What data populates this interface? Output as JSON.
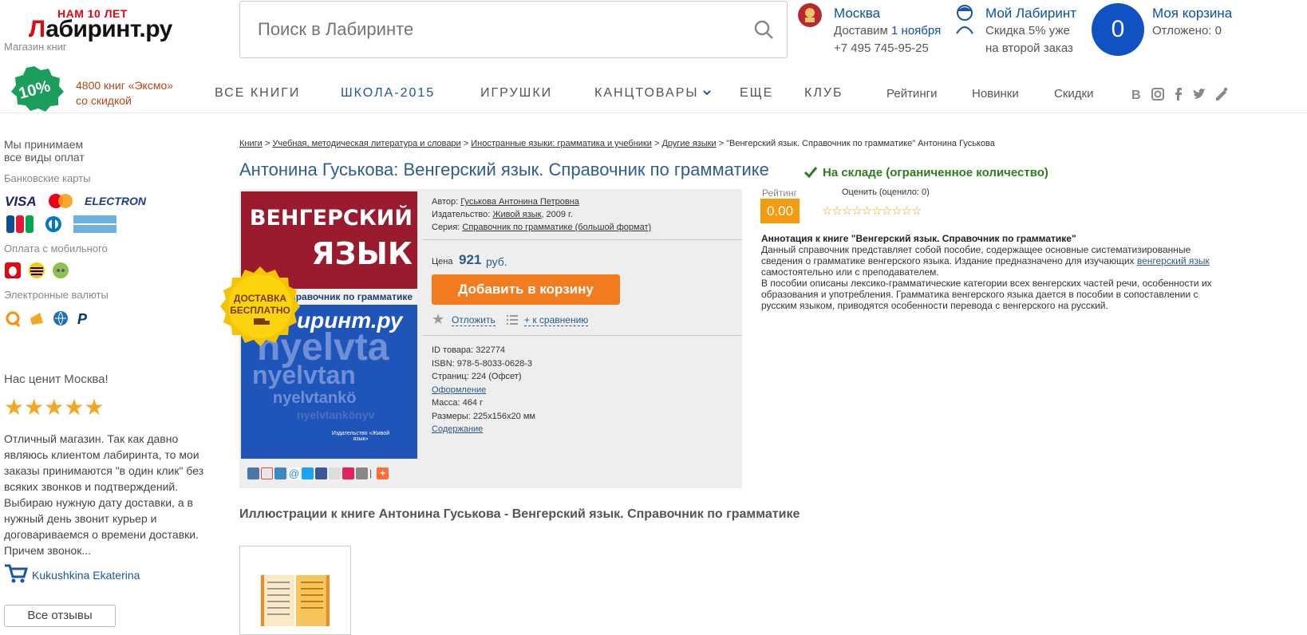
{
  "header": {
    "logo_top": "НАМ 10 ЛЕТ",
    "logo_l": "Л",
    "logo_rest": "абиринт.ру",
    "logo_sub": "Магазин книг",
    "search_placeholder": "Поиск в Лабиринте",
    "city": "Москва",
    "delivery_prefix": "Доставим",
    "delivery_date": "1 ноября",
    "phone": "+7 495 745-95-25",
    "my_title": "Мой Лабиринт",
    "my_line1": "Скидка 5% уже",
    "my_line2": "на второй заказ",
    "cart_count": "0",
    "cart_title": "Моя корзина",
    "cart_postponed": "Отложено: 0"
  },
  "promo": {
    "badge": "10%",
    "line1": "4800 книг «Эксмо»",
    "line2": "со скидкой"
  },
  "nav": {
    "all_books": "ВСЕ КНИГИ",
    "school": "ШКОЛА-2015",
    "toys": "ИГРУШКИ",
    "stationery": "КАНЦТОВАРЫ",
    "more": "ЕЩЕ",
    "club": "КЛУБ",
    "ratings": "Рейтинги",
    "new": "Новинки",
    "sales": "Скидки"
  },
  "left": {
    "accept1": "Мы принимаем",
    "accept2": "все виды оплат",
    "bank_cards": "Банковские карты",
    "electron": "ELECTRON",
    "mobile": "Оплата с мобильного",
    "ewallets": "Электронные валюты",
    "moscow": "Нас ценит Москва!",
    "review": "Отличный магазин. Так как давно являюсь клиентом лабиринта, то мои заказы принимаются \"в один клик\" без всяких звонков и подтверждений. Выбираю нужную дату доставки, а в нужный день звонит курьер и договариваемся о времени доставки. Причем звонок...",
    "reviewer": "Kukushkina Ekaterina",
    "all_reviews": "Все отзывы"
  },
  "breadcrumb": {
    "c1": "Книги",
    "c2": "Учебная, методическая литература и словари",
    "c3": "Иностранные языки: грамматика и учебники",
    "c4": "Другие языки",
    "current": "\"Венгерский язык. Справочник по грамматике\" Антонина Гуськова",
    "sep": " > "
  },
  "product": {
    "title": "Антонина Гуськова: Венгерский язык. Справочник по грамматике",
    "stock": "На складе (ограниченное количество)",
    "cover_title_1": "Венгерский",
    "cover_title_2": "язык",
    "cover_band": "Справочник по грамматике",
    "cover_logo": "иринт.ру",
    "cover_pub": "Издательство «Живой язык»",
    "free_delivery_1": "ДОСТАВКА",
    "free_delivery_2": "БЕСПЛАТНО",
    "author_label": "Автор:",
    "author": "Гуськова Антонина Петровна",
    "publisher_label": "Издательство:",
    "publisher": "Живой язык",
    "year": ", 2009 г.",
    "series_label": "Серия:",
    "series": "Справочник по грамматике (большой формат)",
    "price_label": "Цена",
    "price": "921",
    "currency": "руб.",
    "add_to_cart": "Добавить в корзину",
    "postpone": "Отложить",
    "compare": "+ к сравнению",
    "id": "ID товара: 322774",
    "isbn": "ISBN: 978-5-8033-0628-3",
    "pages": "Страниц: 224 (Офсет)",
    "design": "Оформление",
    "weight": "Масса: 464 г",
    "size": "Размеры: 225x156x20 мм",
    "contents": "Содержание",
    "rating_label": "Рейтинг",
    "rating": "0.00",
    "rate_label": "Оценить (оценило: 0)",
    "rate_stars": "☆☆☆☆☆☆☆☆☆☆",
    "annot_title": "Аннотация к книге \"Венгерский язык. Справочник по грамматике\"",
    "annot_1": "Данный справочник представляет собой пособие, содержащее основные систематизированные сведения о грамматике венгерского языка. Издание предназначено для изучающих ",
    "annot_link": "венгерский язык",
    "annot_2": " самостоятельно или с преподавателем.",
    "annot_3": "В пособии описаны лексико-грамматические категории всех венгерских частей речи, особенности их образования и употребления. Грамматика венгерского языка дается в пособии в сопоставлении с русским языком, приводятся особенности перевода с венгерского на русский.",
    "illustrations": "Иллюстрации к книге Антонина Гуськова - Венгерский язык. Справочник по грамматике"
  },
  "colors": {
    "brand_red": "#e30613",
    "link_blue": "#0c51a4",
    "cart_blue": "#1052c2",
    "button_orange": "#f37b20",
    "stock_green": "#2e7d1e",
    "rating_orange": "#f39c12"
  }
}
